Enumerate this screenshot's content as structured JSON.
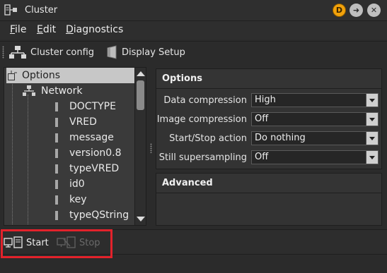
{
  "window": {
    "title": "Cluster",
    "buttons": [
      {
        "name": "d-badge",
        "label": "D"
      },
      {
        "name": "forward",
        "label": "➜"
      },
      {
        "name": "close",
        "label": "✕"
      }
    ]
  },
  "menubar": {
    "items": [
      {
        "label": "File",
        "mnemonic": "F",
        "rest": "ile"
      },
      {
        "label": "Edit",
        "mnemonic": "E",
        "rest": "dit"
      },
      {
        "label": "Diagnostics",
        "mnemonic": "D",
        "rest": "iagnostics"
      }
    ]
  },
  "toolbar": {
    "cluster_config": "Cluster config",
    "display_setup": "Display Setup"
  },
  "tree": {
    "root": "Options",
    "network": "Network",
    "leaves": [
      "DOCTYPE",
      "VRED",
      "message",
      "version0.8",
      "typeVRED",
      "id0",
      "key",
      "typeQString"
    ]
  },
  "options": {
    "title": "Options",
    "rows": [
      {
        "label": "Data compression",
        "value": "High"
      },
      {
        "label": "Image compression",
        "value": "Off"
      },
      {
        "label": "Start/Stop action",
        "value": "Do nothing"
      },
      {
        "label": "Still supersampling",
        "value": "Off"
      }
    ]
  },
  "advanced": {
    "title": "Advanced"
  },
  "actions": {
    "start": "Start",
    "stop": "Stop"
  },
  "colors": {
    "highlight": "#e3222b",
    "badge": "#f2a20b",
    "selected_row": "#c7c7c7"
  }
}
